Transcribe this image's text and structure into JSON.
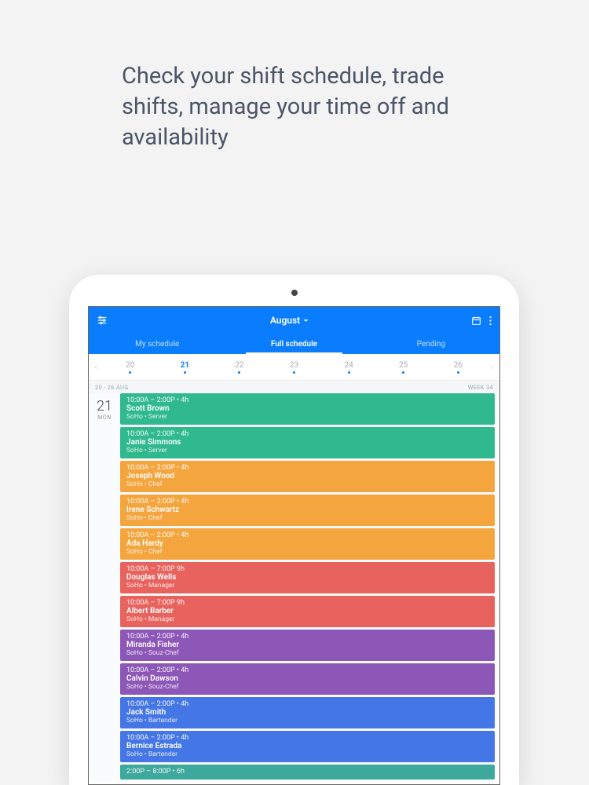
{
  "headline": "Check your shift schedule, trade shifts, manage your time off and availability",
  "appbar": {
    "title": "August"
  },
  "tabs": [
    {
      "label": "My schedule",
      "active": false
    },
    {
      "label": "Full schedule",
      "active": true
    },
    {
      "label": "Pending",
      "active": false
    }
  ],
  "days": [
    {
      "num": "20",
      "active": false
    },
    {
      "num": "21",
      "active": true
    },
    {
      "num": "22",
      "active": false
    },
    {
      "num": "23",
      "active": false
    },
    {
      "num": "24",
      "active": false
    },
    {
      "num": "25",
      "active": false
    },
    {
      "num": "26",
      "active": false
    }
  ],
  "weekbar": {
    "range": "20 - 26 AUG",
    "week": "WEEK 34"
  },
  "date": {
    "num": "21",
    "name": "MON"
  },
  "shifts": [
    {
      "time": "10:00A – 2:00P • 4h",
      "name": "Scott Brown",
      "loc": "SoHo • Server",
      "color": "c-green"
    },
    {
      "time": "10:00A – 2:00P • 4h",
      "name": "Janie Simmons",
      "loc": "SoHo • Server",
      "color": "c-green"
    },
    {
      "time": "10:00A – 2:00P • 4h",
      "name": "Joseph Wood",
      "loc": "SoHo • Chef",
      "color": "c-orange"
    },
    {
      "time": "10:00A – 2:00P • 4h",
      "name": "Irene Schwartz",
      "loc": "SoHo • Chef",
      "color": "c-orange"
    },
    {
      "time": "10:00A – 2:00P • 4h",
      "name": "Ada Hardy",
      "loc": "SoHo • Chef",
      "color": "c-orange"
    },
    {
      "time": "10:00A – 7:00P 9h",
      "name": "Douglas Wells",
      "loc": "SoHo • Manager",
      "color": "c-red"
    },
    {
      "time": "10:00A – 7:00P 9h",
      "name": "Albert Barber",
      "loc": "SoHo • Manager",
      "color": "c-red"
    },
    {
      "time": "10:00A – 2:00P • 4h",
      "name": "Miranda Fisher",
      "loc": "SoHo • Souz-Chef",
      "color": "c-purple"
    },
    {
      "time": "10:00A – 2:00P • 4h",
      "name": "Calvin Dawson",
      "loc": "SoHo • Souz-Chef",
      "color": "c-purple"
    },
    {
      "time": "10:00A – 2:00P • 4h",
      "name": "Jack Smith",
      "loc": "SoHo • Bartender",
      "color": "c-blue"
    },
    {
      "time": "10:00A – 2:00P • 4h",
      "name": "Bernice Estrada",
      "loc": "SoHo • Bartender",
      "color": "c-blue"
    },
    {
      "time": "2:00P – 8:00P • 6h",
      "name": "",
      "loc": "",
      "color": "c-teal2"
    }
  ]
}
